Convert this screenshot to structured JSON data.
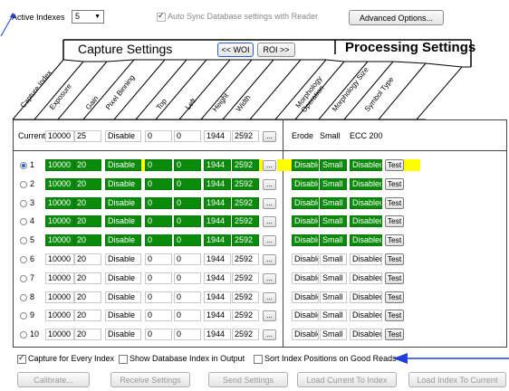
{
  "top": {
    "active_indexes_label": "Active Indexes",
    "active_indexes_value": "5",
    "auto_sync_label": "Auto Sync Database settings with Reader",
    "advanced_label": "Advanced Options..."
  },
  "header": {
    "capture_title": "Capture Settings",
    "processing_title": "Processing Settings",
    "woi_button": "<< WOI",
    "roi_button": "ROI >>",
    "capture_columns": [
      "Capture Index",
      "Exposure",
      "Gain",
      "Pixel Binning",
      "Top",
      "Left",
      "Height",
      "Width"
    ],
    "processing_columns": [
      "Morphology Operation",
      "Morphology Size",
      "Symbol Type"
    ]
  },
  "current": {
    "label": "Current",
    "exposure": "10000",
    "gain": "25",
    "binning": "Disable",
    "top": "0",
    "left": "0",
    "height": "1944",
    "width": "2592",
    "ellipsis": "...",
    "morph_op": "Erode",
    "morph_size": "Small",
    "symbol": "ECC 200"
  },
  "rows": [
    {
      "index": "1",
      "exposure": "10000",
      "gain": "20",
      "binning": "Disable",
      "top": "0",
      "left": "0",
      "height": "1944",
      "width": "2592",
      "morph_op": "Disable",
      "morph_size": "Small",
      "symbol": "Disabled",
      "test": "Test"
    },
    {
      "index": "2",
      "exposure": "10000",
      "gain": "20",
      "binning": "Disable",
      "top": "0",
      "left": "0",
      "height": "1944",
      "width": "2592",
      "morph_op": "Disable",
      "morph_size": "Small",
      "symbol": "Disabled",
      "test": "Test"
    },
    {
      "index": "3",
      "exposure": "10000",
      "gain": "20",
      "binning": "Disable",
      "top": "0",
      "left": "0",
      "height": "1944",
      "width": "2592",
      "morph_op": "Disable",
      "morph_size": "Small",
      "symbol": "Disabled",
      "test": "Test"
    },
    {
      "index": "4",
      "exposure": "10000",
      "gain": "20",
      "binning": "Disable",
      "top": "0",
      "left": "0",
      "height": "1944",
      "width": "2592",
      "morph_op": "Disable",
      "morph_size": "Small",
      "symbol": "Disabled",
      "test": "Test"
    },
    {
      "index": "5",
      "exposure": "10000",
      "gain": "20",
      "binning": "Disable",
      "top": "0",
      "left": "0",
      "height": "1944",
      "width": "2592",
      "morph_op": "Disable",
      "morph_size": "Small",
      "symbol": "Disabled",
      "test": "Test"
    },
    {
      "index": "6",
      "exposure": "10000",
      "gain": "20",
      "binning": "Disable",
      "top": "0",
      "left": "0",
      "height": "1944",
      "width": "2592",
      "morph_op": "Disable",
      "morph_size": "Small",
      "symbol": "Disabled",
      "test": "Test"
    },
    {
      "index": "7",
      "exposure": "10000",
      "gain": "20",
      "binning": "Disable",
      "top": "0",
      "left": "0",
      "height": "1944",
      "width": "2592",
      "morph_op": "Disable",
      "morph_size": "Small",
      "symbol": "Disabled",
      "test": "Test"
    },
    {
      "index": "8",
      "exposure": "10000",
      "gain": "20",
      "binning": "Disable",
      "top": "0",
      "left": "0",
      "height": "1944",
      "width": "2592",
      "morph_op": "Disable",
      "morph_size": "Small",
      "symbol": "Disabled",
      "test": "Test"
    },
    {
      "index": "9",
      "exposure": "10000",
      "gain": "20",
      "binning": "Disable",
      "top": "0",
      "left": "0",
      "height": "1944",
      "width": "2592",
      "morph_op": "Disable",
      "morph_size": "Small",
      "symbol": "Disabled",
      "test": "Test"
    },
    {
      "index": "10",
      "exposure": "10000",
      "gain": "20",
      "binning": "Disable",
      "top": "0",
      "left": "0",
      "height": "1944",
      "width": "2592",
      "morph_op": "Disable",
      "morph_size": "Small",
      "symbol": "Disabled",
      "test": "Test"
    }
  ],
  "active_rows": 5,
  "selected_row": 1,
  "options": {
    "capture_every": "Capture for Every Index",
    "show_db_index": "Show Database Index in Output",
    "sort_index": "Sort Index Positions on Good Reads"
  },
  "bottom_buttons": [
    "Calibrate...",
    "Receive Settings",
    "Send Settings",
    "Load Current To Index",
    "Load Index To Current"
  ],
  "colors": {
    "active_green": "#0b8b0b",
    "highlight_yellow": "#ffff00",
    "arrow_blue": "#1f3fd6"
  },
  "icons": {
    "arrow_top": "arrow-pointer-icon",
    "arrow_bottom": "arrow-pointer-icon"
  }
}
